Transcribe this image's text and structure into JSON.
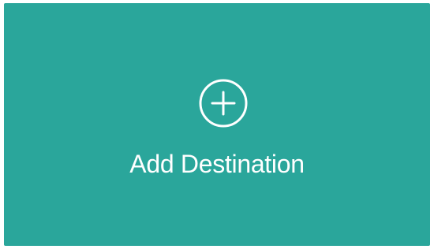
{
  "card": {
    "label": "Add Destination",
    "icon": "add-circle-icon",
    "background_color": "#2aa69b",
    "foreground_color": "#ffffff"
  }
}
